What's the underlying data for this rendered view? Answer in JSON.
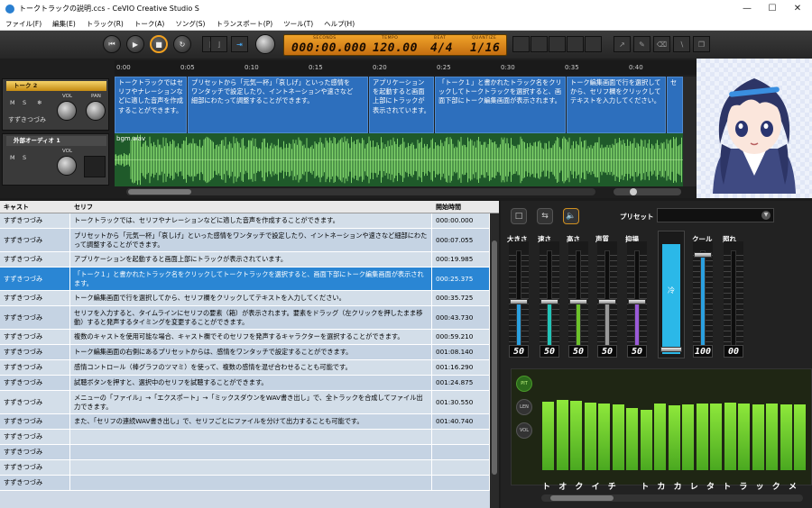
{
  "window": {
    "title": "トークトラックの説明.ccs - CeVIO Creative Studio S"
  },
  "menu": [
    "ファイル(F)",
    "編集(E)",
    "トラック(R)",
    "トーク(A)",
    "ソング(S)",
    "トランスポート(P)",
    "ツール(T)",
    "ヘルプ(H)"
  ],
  "transport": {
    "seconds_label": "SECONDS",
    "seconds": "000:00.000",
    "tempo_label": "TEMPO",
    "tempo": "120.00",
    "beat_label": "BEAT",
    "beat": "4/4",
    "quantize_label": "QUANTIZE",
    "quantize": "1/16"
  },
  "ruler": [
    "0:00",
    "0:05",
    "0:10",
    "0:15",
    "0:20",
    "0:25",
    "0:30",
    "0:35",
    "0:40"
  ],
  "tracks": {
    "talk": {
      "name": "トーク 2",
      "m": "M",
      "s": "S",
      "vol": "VOL",
      "pan": "PAN",
      "cast": "すずきつづみ"
    },
    "audio": {
      "name": "外部オーディオ 1",
      "m": "M",
      "s": "S",
      "vol": "VOL",
      "file": "bgm.wav"
    }
  },
  "clips": [
    "トークトラックではセリフやナレーションなどに適した音声を作成することができます。",
    "プリセットから「元気一杯」「哀しげ」といった感情をワンタッチで設定したり、イントネーションや速さなど細部にわたって調整することができます。",
    "アプリケーションを起動すると画面上部にトラックが表示されています。",
    "「トーク１」と書かれたトラック名をクリックしてトークトラックを選択すると、画面下部にトーク編集画面が表示されます。",
    "トーク編集画面で行を選択してから、セリフ欄をクリックしてテキストを入力してください。",
    "セ"
  ],
  "grid": {
    "headers": {
      "cast": "キャスト",
      "line": "セリフ",
      "start": "開始時間"
    },
    "rows": [
      {
        "cast": "すずきつづみ",
        "line": "トークトラックでは、セリフやナレーションなどに適した音声を作成することができます。",
        "start": "000:00.000"
      },
      {
        "cast": "すずきつづみ",
        "line": "プリセットから「元気一杯」「哀しげ」といった感情をワンタッチで設定したり、イントネーションや速さなど細部にわたって調整することができます。",
        "start": "000:07.055"
      },
      {
        "cast": "すずきつづみ",
        "line": "アプリケーションを起動すると画面上部にトラックが表示されています。",
        "start": "000:19.985"
      },
      {
        "cast": "すずきつづみ",
        "line": "「トーク１」と書かれたトラック名をクリックしてトークトラックを選択すると、画面下部にトーク編集画面が表示されます。",
        "start": "000:25.375"
      },
      {
        "cast": "すずきつづみ",
        "line": "トーク編集画面で行を選択してから、セリフ欄をクリックしてテキストを入力してください。",
        "start": "000:35.725"
      },
      {
        "cast": "すずきつづみ",
        "line": "セリフを入力すると、タイムラインにセリフの要素（箱）が表示されます。要素をドラッグ（左クリックを押したまま移動）すると発声するタイミングを変更することができます。",
        "start": "000:43.730"
      },
      {
        "cast": "すずきつづみ",
        "line": "複数のキャストを使用可能な場合、キャスト欄でそのセリフを発声するキャラクターを選択することができます。",
        "start": "000:59.210"
      },
      {
        "cast": "すずきつづみ",
        "line": "トーク編集画面の右側にあるプリセットからは、感情をワンタッチで設定することができます。",
        "start": "001:08.140"
      },
      {
        "cast": "すずきつづみ",
        "line": "感情コントロール（棒グラフのツマミ）を使って、複数の感情を混ぜ合わせることも可能です。",
        "start": "001:16.290"
      },
      {
        "cast": "すずきつづみ",
        "line": "試聴ボタンを押すと、選択中のセリフを試聴することができます。",
        "start": "001:24.875"
      },
      {
        "cast": "すずきつづみ",
        "line": "メニューの「ファイル」→「エクスポート」→「ミックスダウンをWAV書き出し」で、全トラックを合成してファイル出力できます。",
        "start": "001:30.550"
      },
      {
        "cast": "すずきつづみ",
        "line": "また、「セリフの連続WAV書き出し」で、セリフごとにファイルを分けて出力することも可能です。",
        "start": "001:40.740"
      },
      {
        "cast": "すずきつづみ",
        "line": "",
        "start": ""
      },
      {
        "cast": "すずきつづみ",
        "line": "",
        "start": ""
      },
      {
        "cast": "すずきつづみ",
        "line": "",
        "start": ""
      },
      {
        "cast": "すずきつづみ",
        "line": "",
        "start": ""
      }
    ]
  },
  "panel": {
    "preset_label": "プリセット",
    "sliders": [
      {
        "label": "大きさ",
        "value": "50",
        "level": 0.5,
        "color": "#2aa0e0"
      },
      {
        "label": "速さ",
        "value": "50",
        "level": 0.5,
        "color": "#22c4b8"
      },
      {
        "label": "高さ",
        "value": "50",
        "level": 0.5,
        "color": "#6cc22a"
      },
      {
        "label": "声質",
        "value": "50",
        "level": 0.5,
        "color": "#9a9a9a"
      },
      {
        "label": "抑揚",
        "value": "50",
        "level": 0.5,
        "color": "#9a5ad8"
      }
    ],
    "emotion_big": {
      "label": "冷",
      "level": 0.95,
      "color": "#2bb8e8"
    },
    "emotions": [
      {
        "label": "クール",
        "value": "100",
        "level": 1.0,
        "color": "#2aa0e0"
      },
      {
        "label": "照れ",
        "value": "00",
        "level": 0.0,
        "color": "#e06080"
      }
    ],
    "side_buttons": [
      "PIT",
      "LEN",
      "VOL"
    ],
    "kana": [
      "ト",
      "オ",
      "ク",
      "イ",
      "チ",
      "",
      "ト",
      "カ",
      "カ",
      "レ",
      "タ",
      "ト",
      "ラ",
      "ッ",
      "ク",
      "メ"
    ],
    "bar_levels": [
      0.68,
      0.7,
      0.69,
      0.67,
      0.66,
      0.65,
      0.62,
      0.6,
      0.66,
      0.64,
      0.65,
      0.66,
      0.66,
      0.67,
      0.66,
      0.65,
      0.66,
      0.65,
      0.65
    ]
  }
}
